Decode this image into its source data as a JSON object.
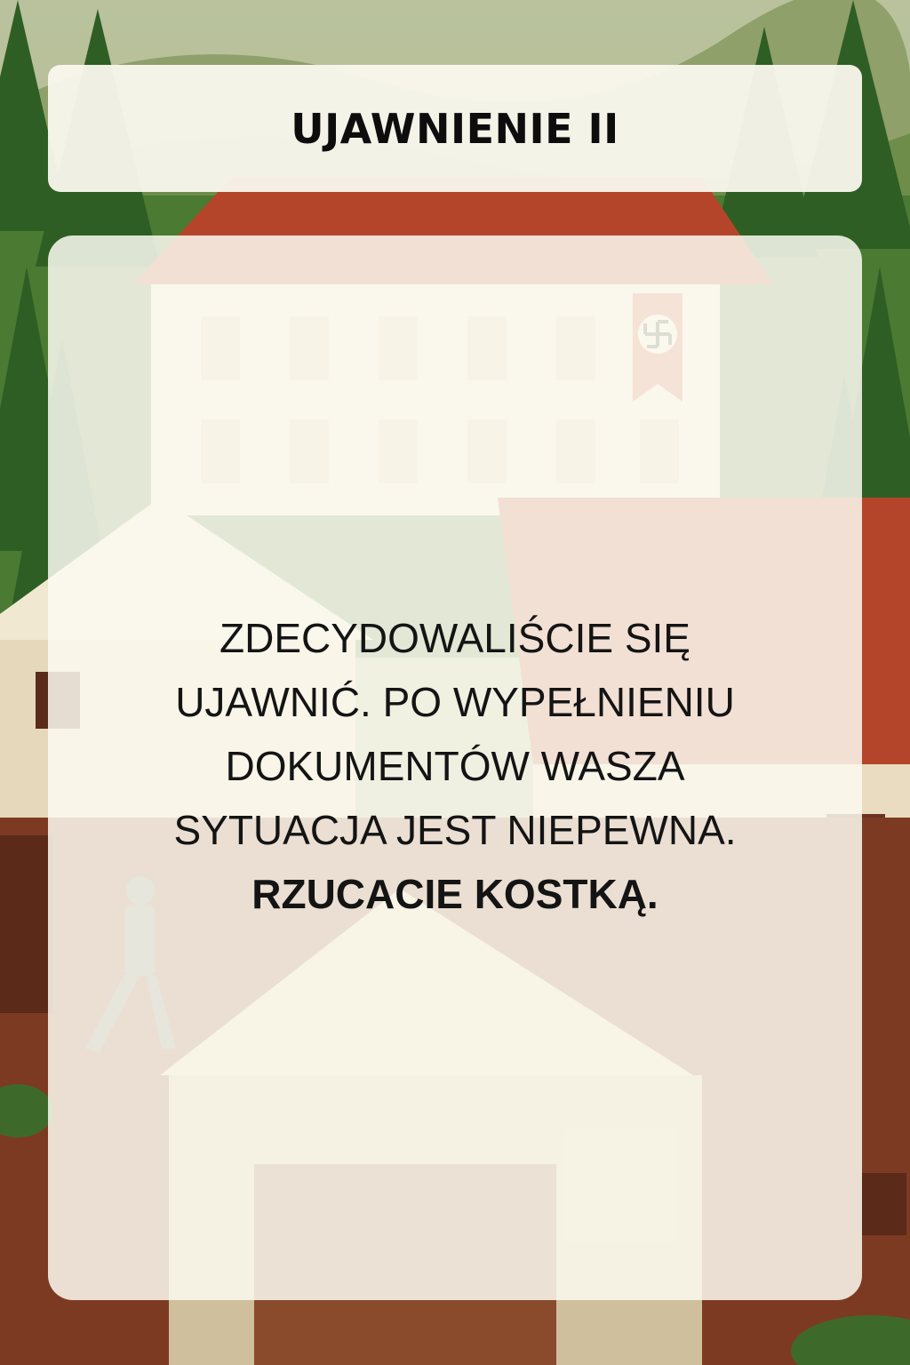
{
  "header": {
    "title": "UJAWNIENIE II"
  },
  "card": {
    "paragraph_lines": [
      "ZDECYDOWALIŚCIE SIĘ",
      "UJAWNIĆ. PO WYPEŁNIENIU",
      "DOKUMENTÓW WASZA",
      "SYTUACJA JEST NIEPEWNA."
    ],
    "action": "RZUCACIE KOSTKĄ."
  },
  "background": {
    "description_icons": [
      "forest-trees",
      "manor-building",
      "swastika-banner",
      "walking-person",
      "house",
      "barn"
    ],
    "colors": {
      "sky": "#a9b58f",
      "hills": "#8fa06a",
      "forest": "#3f6e2c",
      "roof": "#b5452a",
      "wall": "#efe6d0",
      "wood": "#6b3220",
      "card": "#fcfaf0"
    }
  }
}
